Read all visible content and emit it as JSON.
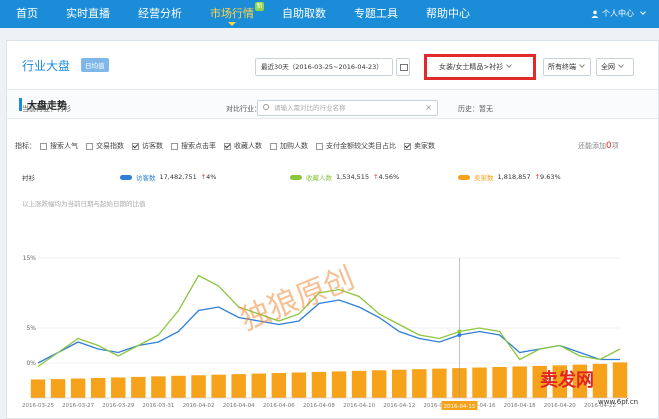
{
  "nav": {
    "items": [
      {
        "label": "首页"
      },
      {
        "label": "实时直播"
      },
      {
        "label": "经营分析"
      },
      {
        "label": "市场行情",
        "active": true,
        "badge": "新"
      },
      {
        "label": "自助取数"
      },
      {
        "label": "专题工具"
      },
      {
        "label": "帮助中心"
      }
    ],
    "user_label": "个人中心"
  },
  "header": {
    "title": "行业大盘",
    "tag": "日均值",
    "date_range": "最近30天（2016-03-25~2016-04-23）",
    "category": "女装/女士精品>衬衫",
    "terminal": "所有终端",
    "network": "全网"
  },
  "section": {
    "title": "大盘走势"
  },
  "filters": {
    "current_label": "当前行业：",
    "current_value": "衬衫",
    "compare_label": "对比行业：",
    "compare_placeholder": "请输入需对比的行业名称",
    "history_label": "历史：",
    "history_value": "暂无"
  },
  "metrics": {
    "label": "指标：",
    "items": [
      {
        "label": "搜索人气",
        "checked": false
      },
      {
        "label": "交易指数",
        "checked": false
      },
      {
        "label": "访客数",
        "checked": true
      },
      {
        "label": "搜索点击率",
        "checked": false
      },
      {
        "label": "收藏人数",
        "checked": true
      },
      {
        "label": "加购人数",
        "checked": false
      },
      {
        "label": "支付金额较父类目占比",
        "checked": false
      },
      {
        "label": "卖家数",
        "checked": true
      }
    ],
    "add_prefix": "还能添加",
    "add_count": "0",
    "add_suffix": "项"
  },
  "legend": {
    "row_label": "衬衫",
    "series": [
      {
        "name": "访客数",
        "value": "17,482,751",
        "change": "4%",
        "color": "#2f7ed8"
      },
      {
        "name": "收藏人数",
        "value": "1,534,515",
        "change": "4.56%",
        "color": "#8cc63f"
      },
      {
        "name": "卖家数",
        "value": "1,818,857",
        "change": "9.63%",
        "color": "#f7a21b"
      }
    ]
  },
  "chart_note": "以上涨跌幅均为当前日期与起始日期的比值",
  "chart_data": {
    "type": "line",
    "x": [
      "2016-03-25",
      "2016-03-26",
      "2016-03-27",
      "2016-03-28",
      "2016-03-29",
      "2016-03-30",
      "2016-03-31",
      "2016-04-01",
      "2016-04-02",
      "2016-04-03",
      "2016-04-04",
      "2016-04-05",
      "2016-04-06",
      "2016-04-07",
      "2016-04-08",
      "2016-04-09",
      "2016-04-10",
      "2016-04-11",
      "2016-04-12",
      "2016-04-13",
      "2016-04-14",
      "2016-04-15",
      "2016-04-16",
      "2016-04-17",
      "2016-04-18",
      "2016-04-19",
      "2016-04-20",
      "2016-04-21",
      "2016-04-22",
      "2016-04-23"
    ],
    "x_tick_labels": [
      "2016-03-25",
      "2016-03-27",
      "2016-03-29",
      "2016-03-31",
      "2016-04-02",
      "2016-04-04",
      "2016-04-06",
      "2016-04-08",
      "2016-04-10",
      "2016-04-12",
      "2016-04-14",
      "2016-04-16",
      "2016-04-18",
      "2016-04-20",
      "2016-04-22"
    ],
    "highlight_x": "2016-04-15",
    "y_ticks": [
      "15%",
      "5%",
      "0%"
    ],
    "ylim": [
      -5,
      15
    ],
    "series": [
      {
        "name": "访客数",
        "color": "#2f7ed8",
        "values": [
          0,
          1.5,
          3,
          2,
          1.5,
          2.5,
          3,
          4.5,
          7.5,
          8,
          6.5,
          6,
          5.5,
          6,
          8.5,
          9,
          8,
          6.5,
          4.5,
          3.5,
          3,
          4,
          4.5,
          4,
          1.5,
          2,
          2.5,
          1.5,
          0.5,
          0.5
        ]
      },
      {
        "name": "收藏人数",
        "color": "#8cc63f",
        "values": [
          -0.5,
          1.5,
          3.5,
          2.5,
          1,
          2.5,
          4,
          7.5,
          12.5,
          11,
          8,
          7,
          6,
          7,
          10,
          10.5,
          9.5,
          7,
          5.5,
          4,
          3.5,
          4.5,
          5,
          4.5,
          0.5,
          2,
          2.5,
          1,
          0.5,
          2
        ]
      },
      {
        "name": "卖家数",
        "type": "bar",
        "color": "#f7a21b",
        "values": [
          0.3,
          0.5,
          0.8,
          1.1,
          1.4,
          1.7,
          2.0,
          2.3,
          2.6,
          2.9,
          3.2,
          3.5,
          3.8,
          4.1,
          4.4,
          4.7,
          5.0,
          5.3,
          5.6,
          5.9,
          6.2,
          6.5,
          6.8,
          7.1,
          7.4,
          7.7,
          8.0,
          8.4,
          8.8,
          9.63
        ]
      }
    ]
  },
  "watermark": "独狼原创",
  "logo": {
    "text": "卖发网",
    "site": "www.6pf.cn"
  }
}
